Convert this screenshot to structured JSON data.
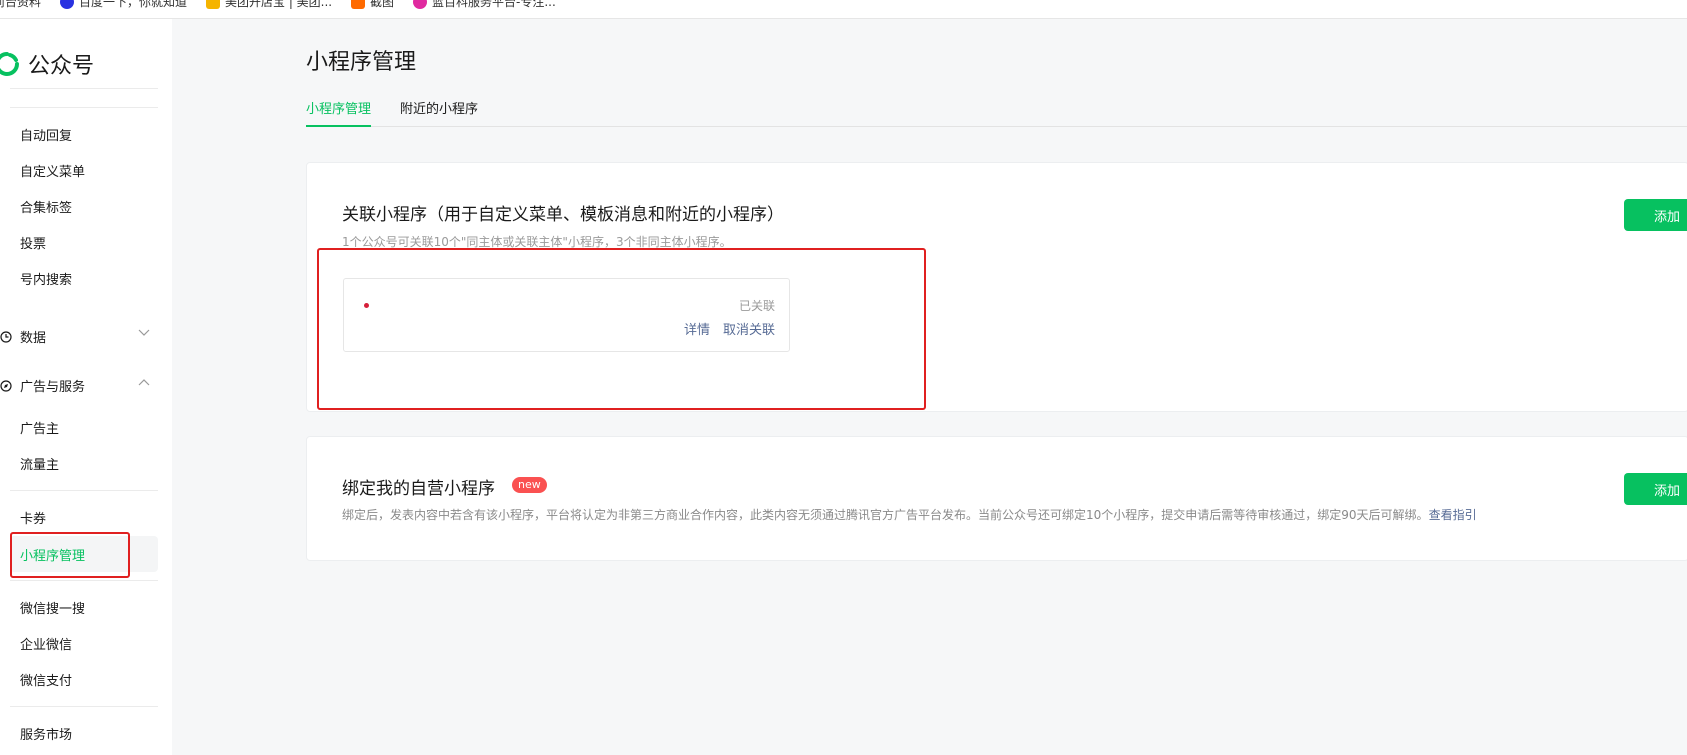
{
  "bookmarks": [
    {
      "label": "前台资料",
      "color": "#ffffff"
    },
    {
      "label": "百度一下，你就知道",
      "color": "#2932e1"
    },
    {
      "label": "美团开店宝 | 美团...",
      "color": "#f5b400"
    },
    {
      "label": "截图",
      "color": "#ff6a00"
    },
    {
      "label": "蓝百科服务平台-专注...",
      "color": "#e02aa0"
    }
  ],
  "sidebar": {
    "brand": "公众号",
    "items": [
      "自动回复",
      "自定义菜单",
      "合集标签",
      "投票",
      "号内搜索"
    ],
    "group_data": "数据",
    "group_ads": "广告与服务",
    "ads_items": [
      "广告主",
      "流量主"
    ],
    "card_coupon": "卡券",
    "active_item": "小程序管理",
    "more_items": [
      "微信搜一搜",
      "企业微信",
      "微信支付"
    ],
    "service_market": "服务市场"
  },
  "main": {
    "title": "小程序管理",
    "tabs": [
      "小程序管理",
      "附近的小程序"
    ],
    "linked": {
      "title": "关联小程序（用于自定义菜单、模板消息和附近的小程序）",
      "desc": "1个公众号可关联10个\"同主体或关联主体\"小程序，3个非同主体小程序。",
      "add": "添加",
      "item_status": "已关联",
      "item_detail": "详情",
      "item_unlink": "取消关联"
    },
    "bound": {
      "title": "绑定我的自营小程序",
      "badge": "new",
      "desc": "绑定后，发表内容中若含有该小程序，平台将认定为非第三方商业合作内容，此类内容无须通过腾讯官方广告平台发布。当前公众号还可绑定10个小程序，提交申请后需等待审核通过，绑定90天后可解绑。",
      "guide": "查看指引",
      "add": "添加"
    }
  },
  "colors": {
    "accent": "#07c160",
    "link": "#576b95",
    "highlight": "#e02020",
    "badge": "#fa5151"
  }
}
